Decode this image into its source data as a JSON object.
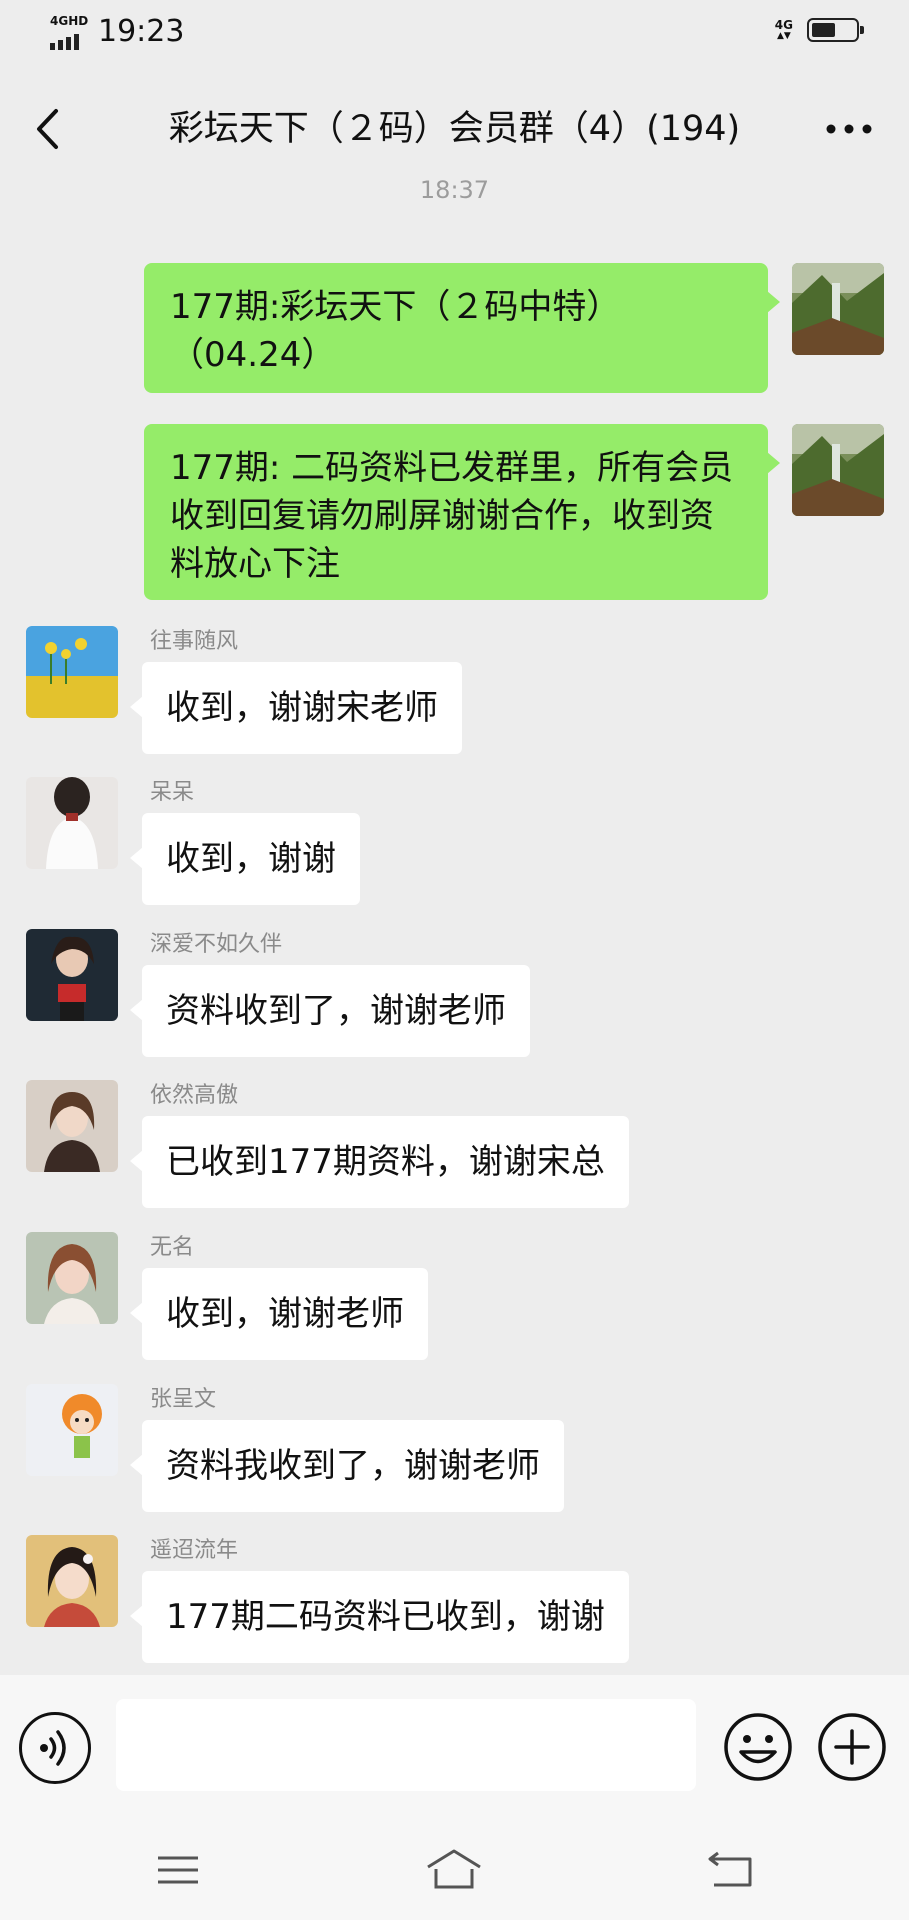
{
  "status_bar": {
    "network_left": "4GHD",
    "time": "19:23",
    "network_right": "4G",
    "battery_level": 0.55
  },
  "header": {
    "title": "彩坛天下（２码）会员群（4）(194)"
  },
  "chat": {
    "timestamp": "18:37",
    "self_messages": [
      {
        "text": "177期:彩坛天下（２码中特）（04.24）"
      },
      {
        "text": "177期: 二码资料已发群里，所有会员收到回复请勿刷屏谢谢合作，收到资料放心下注"
      }
    ],
    "messages": [
      {
        "sender": "往事随风",
        "text": "收到，谢谢宋老师"
      },
      {
        "sender": "呆呆",
        "text": "收到，谢谢"
      },
      {
        "sender": "深爱不如久伴",
        "text": "资料收到了，谢谢老师"
      },
      {
        "sender": "依然高傲",
        "text": "已收到177期资料，谢谢宋总"
      },
      {
        "sender": "无名",
        "text": "收到，谢谢老师"
      },
      {
        "sender": "张呈文",
        "text": "资料我收到了，谢谢老师"
      },
      {
        "sender": "遥迢流年",
        "text": "177期二码资料已收到，谢谢"
      }
    ]
  },
  "input_bar": {
    "placeholder": ""
  },
  "icons": {
    "back": "chevron-left-icon",
    "more": "more-icon",
    "voice": "voice-icon",
    "emoji": "emoji-icon",
    "plus": "plus-icon",
    "nav_menu": "menu-icon",
    "nav_home": "home-icon",
    "nav_back": "back-icon"
  },
  "colors": {
    "self_bubble": "#95ec69",
    "other_bubble": "#ffffff",
    "background": "#ededed"
  }
}
